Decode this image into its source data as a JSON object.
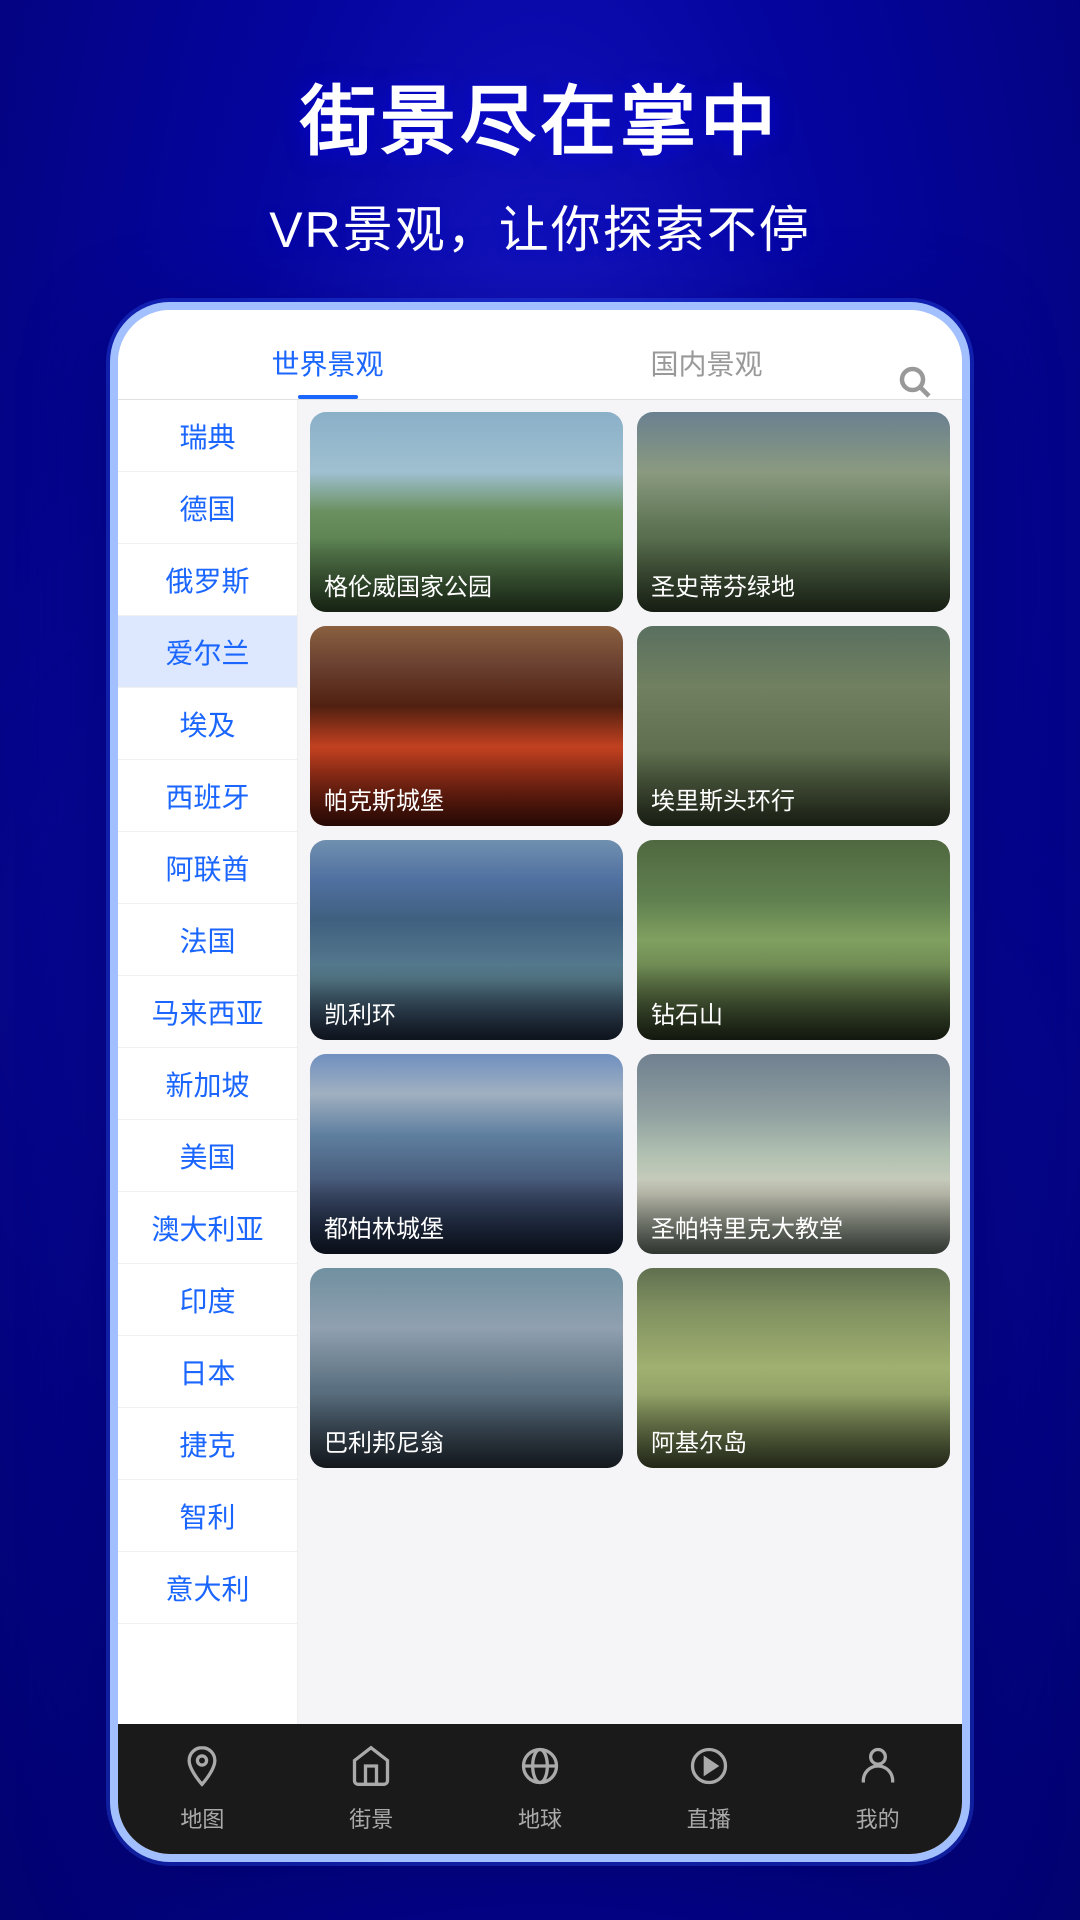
{
  "hero": {
    "title": "街景尽在掌中",
    "subtitle": "VR景观，让你探索不停"
  },
  "tabs": [
    {
      "label": "世界景观",
      "active": true
    },
    {
      "label": "国内景观",
      "active": false
    }
  ],
  "sidebar": {
    "items": [
      {
        "label": "瑞典",
        "active": false
      },
      {
        "label": "德国",
        "active": false
      },
      {
        "label": "俄罗斯",
        "active": false
      },
      {
        "label": "爱尔兰",
        "active": true
      },
      {
        "label": "埃及",
        "active": false
      },
      {
        "label": "西班牙",
        "active": false
      },
      {
        "label": "阿联酋",
        "active": false
      },
      {
        "label": "法国",
        "active": false
      },
      {
        "label": "马来西亚",
        "active": false
      },
      {
        "label": "新加坡",
        "active": false
      },
      {
        "label": "美国",
        "active": false
      },
      {
        "label": "澳大利亚",
        "active": false
      },
      {
        "label": "印度",
        "active": false
      },
      {
        "label": "日本",
        "active": false
      },
      {
        "label": "捷克",
        "active": false
      },
      {
        "label": "智利",
        "active": false
      },
      {
        "label": "意大利",
        "active": false
      }
    ]
  },
  "grid": {
    "items": [
      {
        "label": "格伦威国家公园",
        "img_class": "img-1"
      },
      {
        "label": "圣史蒂芬绿地",
        "img_class": "img-2"
      },
      {
        "label": "帕克斯城堡",
        "img_class": "img-3"
      },
      {
        "label": "埃里斯头环行",
        "img_class": "img-4"
      },
      {
        "label": "凯利环",
        "img_class": "img-5"
      },
      {
        "label": "钻石山",
        "img_class": "img-6"
      },
      {
        "label": "都柏林城堡",
        "img_class": "img-7"
      },
      {
        "label": "圣帕特里克大教堂",
        "img_class": "img-8"
      },
      {
        "label": "巴利邦尼翁",
        "img_class": "img-9"
      },
      {
        "label": "阿基尔岛",
        "img_class": "img-10"
      }
    ]
  },
  "bottom_nav": {
    "items": [
      {
        "label": "地图",
        "icon": "📍"
      },
      {
        "label": "街景",
        "icon": "🏠"
      },
      {
        "label": "地球",
        "icon": "🌍"
      },
      {
        "label": "直播",
        "icon": "▶"
      },
      {
        "label": "我的",
        "icon": "👤"
      }
    ]
  }
}
